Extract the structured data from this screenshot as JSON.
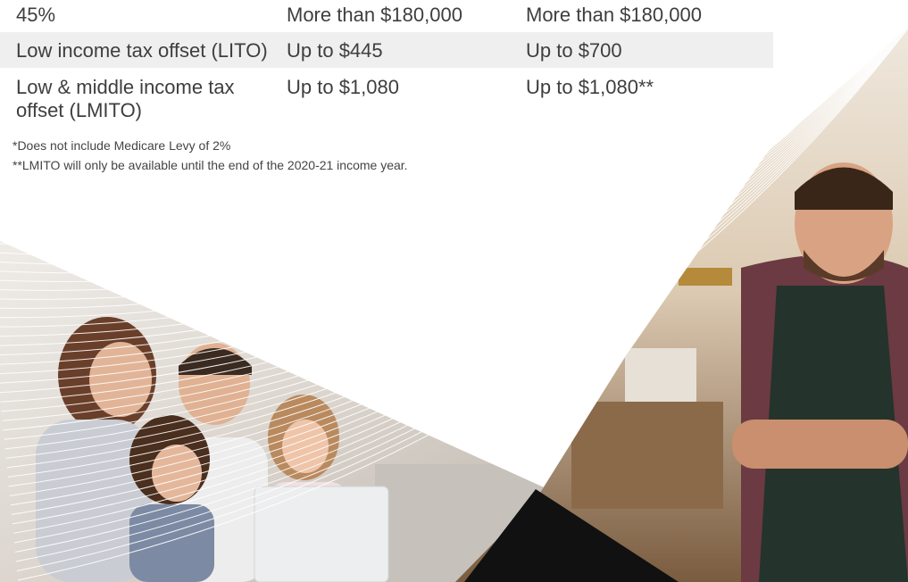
{
  "table": {
    "rows": [
      {
        "label": "45%",
        "col2": "More than $180,000",
        "col3": "More than $180,000"
      },
      {
        "label": "Low income tax offset (LITO)",
        "col2": "Up to $445",
        "col3": "Up to $700"
      },
      {
        "label": "Low & middle income tax offset (LMITO)",
        "col2": "Up to $1,080",
        "col3": "Up to $1,080**"
      }
    ]
  },
  "footnotes": [
    "*Does not include Medicare Levy of 2%",
    "**LMITO will only be available until the end of the 2020-21 income year."
  ],
  "colors": {
    "row_shade": "#efefef",
    "text": "#3e3e3e",
    "wedge": "#111111",
    "sweep_line": "#ffffff"
  },
  "images": {
    "family": "family-with-laptop-photo",
    "tradesman": "smiling-bearded-man-apron-photo"
  }
}
